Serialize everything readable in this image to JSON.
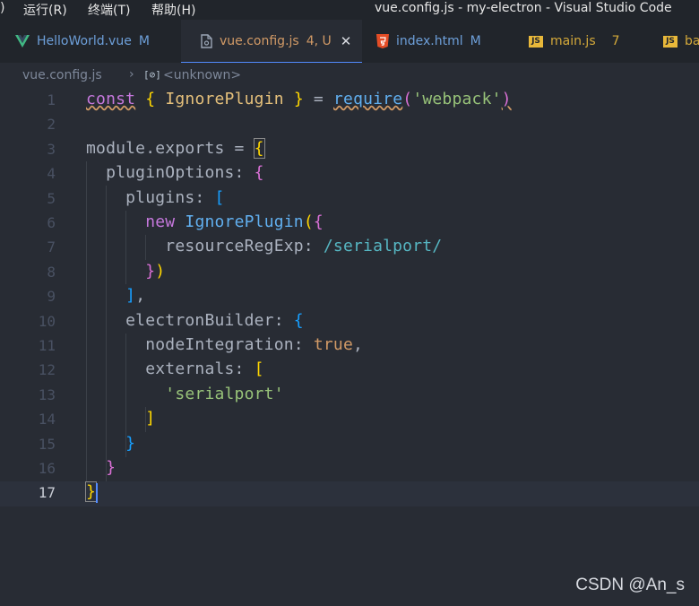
{
  "menu": [
    "运行(R)",
    "终端(T)",
    "帮助(H)"
  ],
  "menu_edge": ")",
  "window_title": "vue.config.js - my-electron - Visual Studio Code",
  "tabs": [
    {
      "label": "HelloWorld.vue",
      "status": "M",
      "icon": "vue-icon"
    },
    {
      "label": "vue.config.js",
      "status": "4, U",
      "icon": "file-config-icon",
      "active": true
    },
    {
      "label": "index.html",
      "status": "M",
      "icon": "html5-icon"
    },
    {
      "label": "main.js",
      "status": "7",
      "icon": "js-icon"
    },
    {
      "label": "ba",
      "status": "",
      "icon": "js-icon"
    }
  ],
  "js_badge": "JS",
  "close_glyph": "✕",
  "breadcrumb": {
    "file": "vue.config.js",
    "separator": "›",
    "symbol_icon": "[⊘]",
    "symbol": "<unknown>"
  },
  "editor": {
    "line_numbers": [
      "1",
      "2",
      "3",
      "4",
      "5",
      "6",
      "7",
      "8",
      "9",
      "10",
      "11",
      "12",
      "13",
      "14",
      "15",
      "16",
      "17"
    ],
    "current_line": 17
  },
  "code": [
    [
      [
        "kw squig",
        "const"
      ],
      [
        "pl",
        " "
      ],
      [
        "br1",
        "{"
      ],
      [
        "pl",
        " "
      ],
      [
        "ty",
        "IgnorePlugin"
      ],
      [
        "pl",
        " "
      ],
      [
        "br1",
        "}"
      ],
      [
        "pl",
        " = "
      ],
      [
        "fn squig",
        "require"
      ],
      [
        "br2",
        "("
      ],
      [
        "str",
        "'webpack'"
      ],
      [
        "br2 squig",
        ")"
      ]
    ],
    [],
    [
      [
        "pl",
        "module.exports = "
      ],
      [
        "br1 br1box",
        "{"
      ]
    ],
    [
      [
        "pl",
        "  pluginOptions: "
      ],
      [
        "br2",
        "{"
      ]
    ],
    [
      [
        "pl",
        "    plugins: "
      ],
      [
        "br3",
        "["
      ]
    ],
    [
      [
        "pl",
        "      "
      ],
      [
        "kw",
        "new"
      ],
      [
        "pl",
        " "
      ],
      [
        "fn",
        "IgnorePlugin"
      ],
      [
        "br1",
        "("
      ],
      [
        "br2",
        "{"
      ]
    ],
    [
      [
        "pl",
        "        resourceRegExp: "
      ],
      [
        "rx",
        "/serialport/"
      ]
    ],
    [
      [
        "pl",
        "      "
      ],
      [
        "br2",
        "}"
      ],
      [
        "br1",
        ")"
      ]
    ],
    [
      [
        "pl",
        "    "
      ],
      [
        "br3",
        "]"
      ],
      [
        "pl",
        ","
      ]
    ],
    [
      [
        "pl",
        "    electronBuilder: "
      ],
      [
        "br3",
        "{"
      ]
    ],
    [
      [
        "pl",
        "      nodeIntegration: "
      ],
      [
        "bool",
        "true"
      ],
      [
        "pl",
        ","
      ]
    ],
    [
      [
        "pl",
        "      externals: "
      ],
      [
        "br1",
        "["
      ]
    ],
    [
      [
        "pl",
        "        "
      ],
      [
        "str",
        "'serialport'"
      ]
    ],
    [
      [
        "pl",
        "      "
      ],
      [
        "br1",
        "]"
      ]
    ],
    [
      [
        "pl",
        "    "
      ],
      [
        "br3",
        "}"
      ]
    ],
    [
      [
        "pl",
        "  "
      ],
      [
        "br2",
        "}"
      ]
    ],
    [
      [
        "br1 br1box",
        "}"
      ]
    ]
  ],
  "watermark": "CSDN @An_s",
  "colors": {
    "background": "#282c34",
    "accent": "#528bff",
    "string": "#98c379",
    "keyword": "#c678dd"
  }
}
